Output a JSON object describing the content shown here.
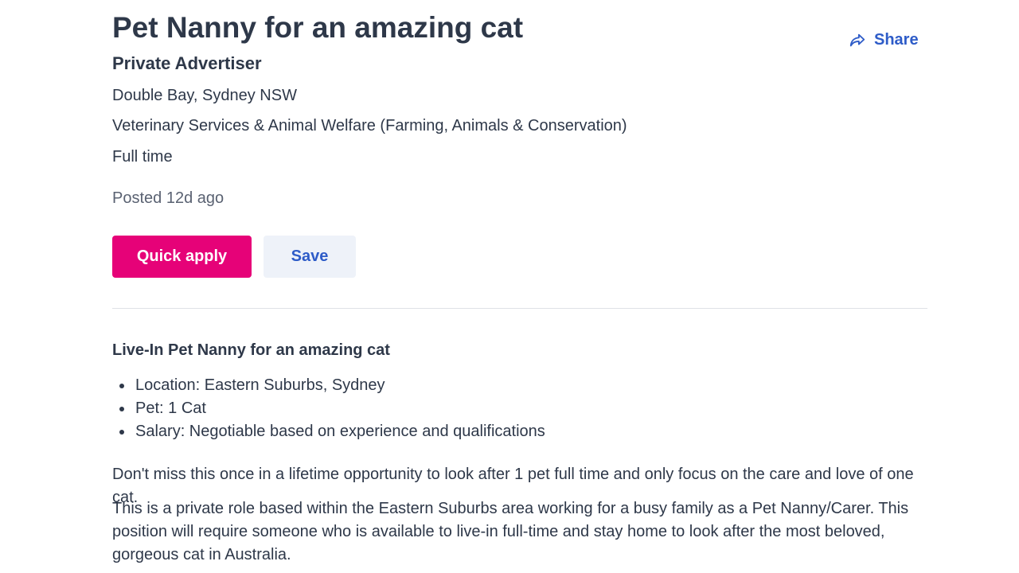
{
  "job": {
    "title": "Pet Nanny for an amazing cat",
    "advertiser": "Private Advertiser",
    "location": "Double Bay, Sydney NSW",
    "category": "Veterinary Services & Animal Welfare (Farming, Animals & Conservation)",
    "work_type": "Full time",
    "posted": "Posted 12d ago"
  },
  "actions": {
    "share_label": "Share",
    "share_icon": "share-arrow-icon",
    "apply_label": "Quick apply",
    "save_label": "Save"
  },
  "colors": {
    "accent_pink": "#e60278",
    "link_blue": "#2e5cc8",
    "text": "#2e3849"
  },
  "description": {
    "heading": "Live-In Pet Nanny for an amazing cat",
    "bullets": [
      "Location: Eastern Suburbs, Sydney",
      "Pet: 1 Cat",
      "Salary: Negotiable based on experience and qualifications"
    ],
    "paragraphs": [
      "Don't miss this once in a lifetime opportunity to look after 1 pet full time and only focus on the care and love of one cat.",
      "This is a private role based within the Eastern Suburbs area working for a busy family as a Pet Nanny/Carer. This position will require someone who is available to live-in full-time and stay home to look after the most beloved, gorgeous cat in Australia."
    ]
  }
}
